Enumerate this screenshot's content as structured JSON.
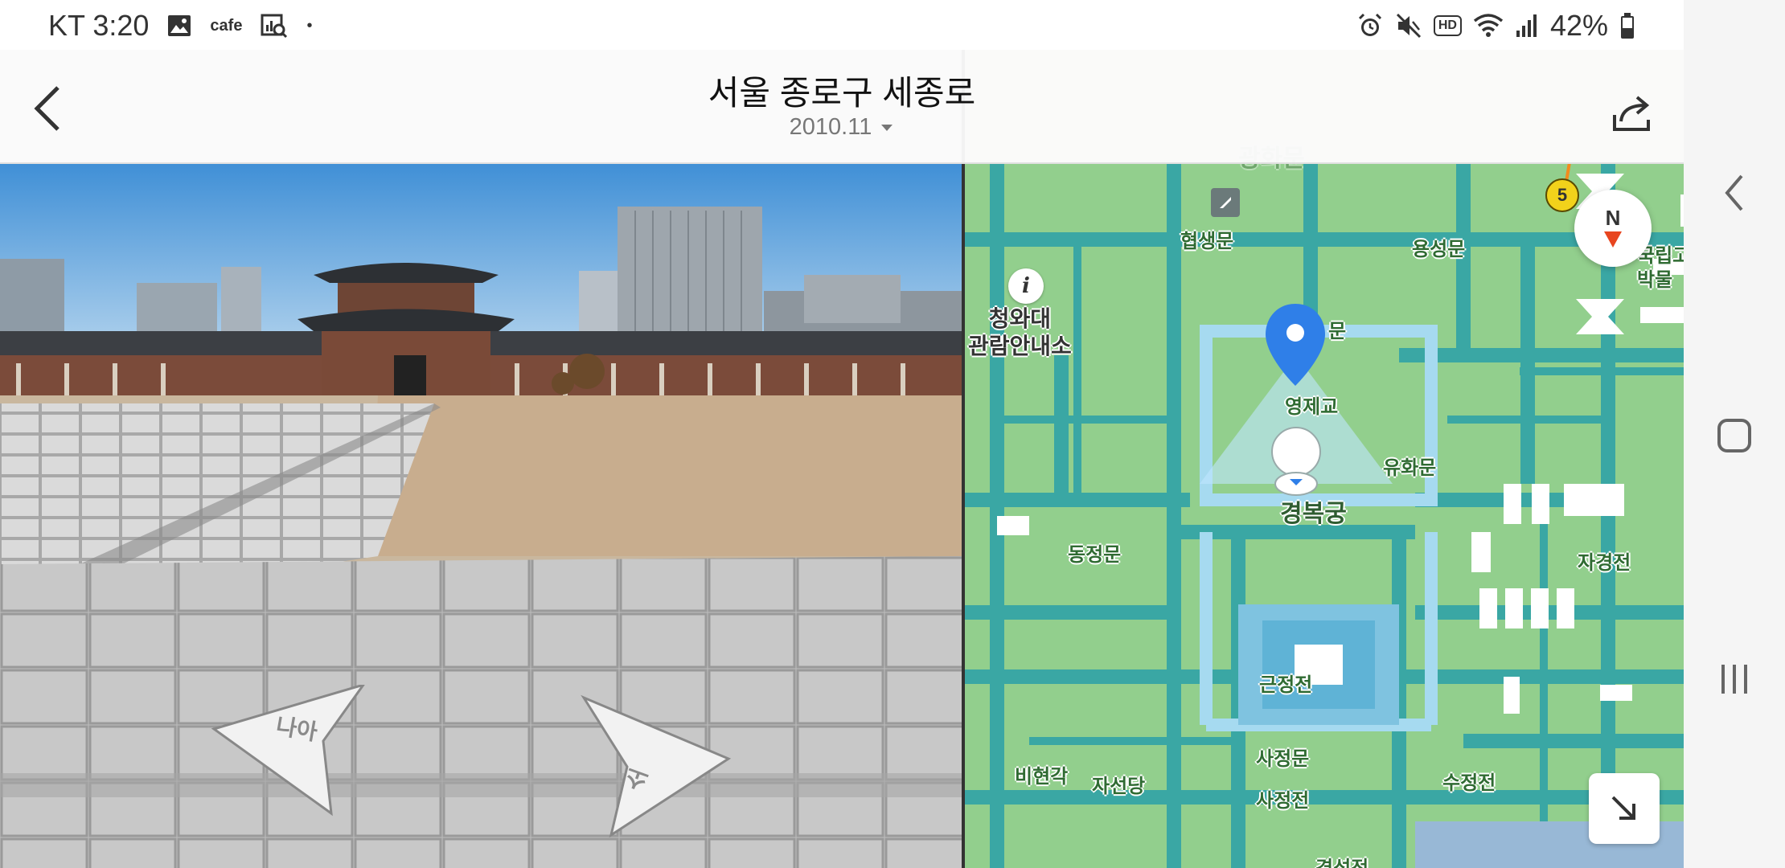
{
  "status_bar": {
    "carrier_time": "KT 3:20",
    "cafe_label": "cafe",
    "dot": "•",
    "hd_label": "HD",
    "battery": "42%",
    "left_icons": [
      "gallery-icon",
      "cafe-icon",
      "chart-search-icon"
    ],
    "right_icons": [
      "alarm-icon",
      "mute-icon",
      "hd-icon",
      "wifi-icon",
      "signal-icon",
      "battery-icon"
    ]
  },
  "header": {
    "title": "서울 종로구 세종로",
    "date": "2010.11"
  },
  "street_view": {
    "arrow_back_label": "나아",
    "arrow_forward_label": "소"
  },
  "map": {
    "labels": {
      "hyeopsaengmun": "협생문",
      "yongseongmun": "용성문",
      "cheongwadae": "청와대\n관람안내소",
      "mun": "문",
      "yeongjegyo": "영제교",
      "yuhwamun": "유화문",
      "gyeongbokgung": "경복궁",
      "dongjeongmun": "동정문",
      "jagyeongjeon": "자경전",
      "geunjeongjeon": "근정전",
      "sajeongmun": "사정문",
      "bihyeongak": "비현각",
      "jaseondang": "자선당",
      "sajeongjeon": "사정전",
      "sujeongjeon": "수정전",
      "gwanghwamun": "광화문",
      "gungnip": "국립고\n박물",
      "bottom_partial": "경성전"
    },
    "subway_line": "5",
    "compass_label": "N",
    "colors": {
      "grass": "#92cf8d",
      "road": "#3aa7a4",
      "road_light": "#a6daf0",
      "pin": "#2f7fe8"
    }
  },
  "nav_bar": {
    "icons": [
      "back-nav-icon",
      "home-nav-icon",
      "recents-nav-icon"
    ]
  }
}
